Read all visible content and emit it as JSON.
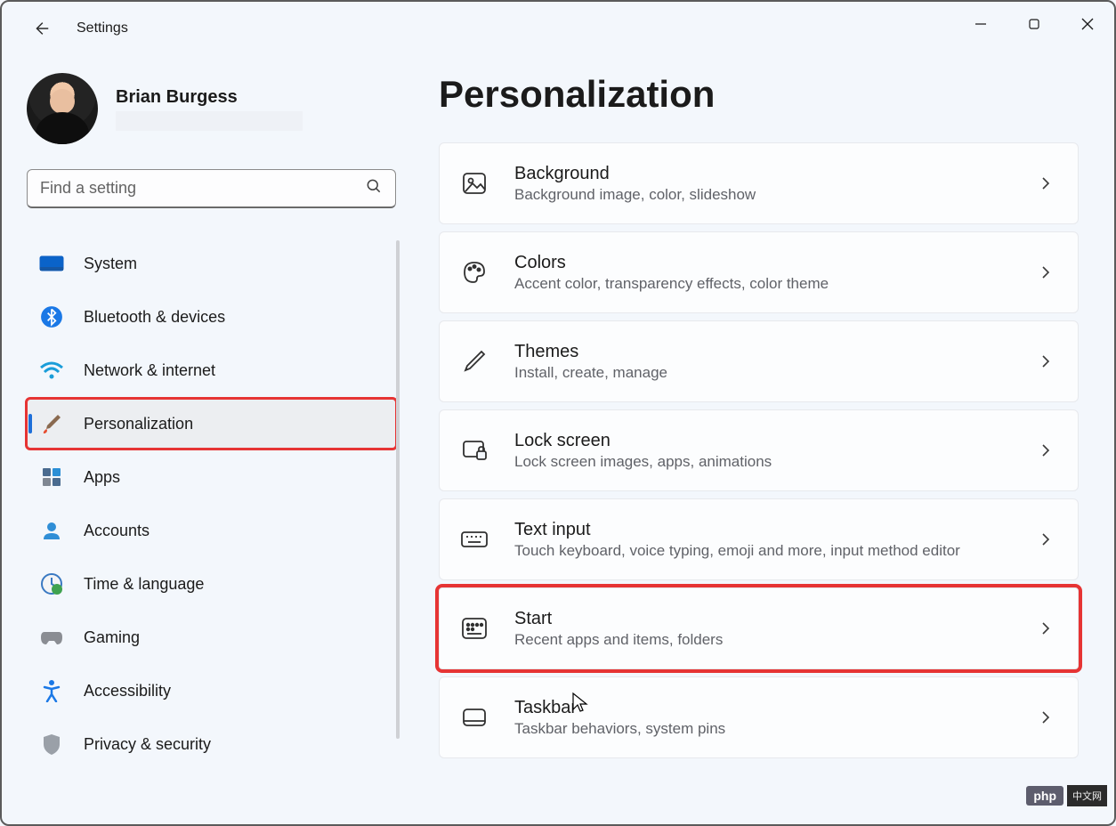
{
  "app_title": "Settings",
  "user": {
    "name": "Brian Burgess"
  },
  "search": {
    "placeholder": "Find a setting"
  },
  "nav": [
    {
      "id": "system",
      "label": "System"
    },
    {
      "id": "bluetooth",
      "label": "Bluetooth & devices"
    },
    {
      "id": "network",
      "label": "Network & internet"
    },
    {
      "id": "personalization",
      "label": "Personalization"
    },
    {
      "id": "apps",
      "label": "Apps"
    },
    {
      "id": "accounts",
      "label": "Accounts"
    },
    {
      "id": "time",
      "label": "Time & language"
    },
    {
      "id": "gaming",
      "label": "Gaming"
    },
    {
      "id": "accessibility",
      "label": "Accessibility"
    },
    {
      "id": "privacy",
      "label": "Privacy & security"
    }
  ],
  "page": {
    "title": "Personalization"
  },
  "cards": [
    {
      "id": "background",
      "title": "Background",
      "sub": "Background image, color, slideshow"
    },
    {
      "id": "colors",
      "title": "Colors",
      "sub": "Accent color, transparency effects, color theme"
    },
    {
      "id": "themes",
      "title": "Themes",
      "sub": "Install, create, manage"
    },
    {
      "id": "lockscreen",
      "title": "Lock screen",
      "sub": "Lock screen images, apps, animations"
    },
    {
      "id": "textinput",
      "title": "Text input",
      "sub": "Touch keyboard, voice typing, emoji and more, input method editor"
    },
    {
      "id": "start",
      "title": "Start",
      "sub": "Recent apps and items, folders"
    },
    {
      "id": "taskbar",
      "title": "Taskbar",
      "sub": "Taskbar behaviors, system pins"
    }
  ],
  "watermark": {
    "left": "php",
    "right": "中文网"
  }
}
